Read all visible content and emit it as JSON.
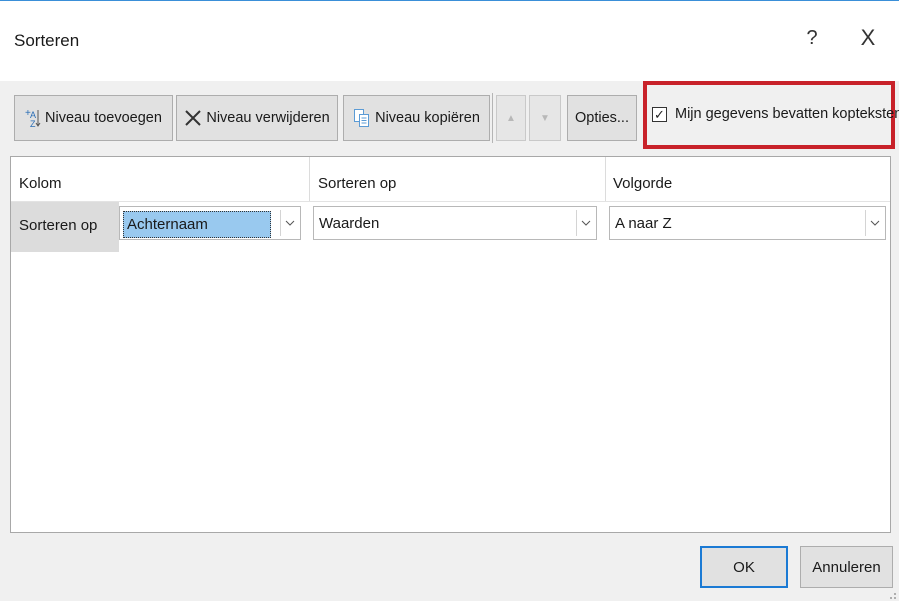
{
  "dialog": {
    "title": "Sorteren",
    "help_label": "?",
    "close_label": "X"
  },
  "toolbar": {
    "add_level_label": "Niveau toevoegen",
    "delete_level_label": "Niveau verwijderen",
    "copy_level_label": "Niveau kopiëren",
    "move_up_label": "▲",
    "move_down_label": "▼",
    "options_label": "Opties...",
    "headers_checkbox_label": "Mijn gegevens bevatten kopteksten",
    "headers_checkbox_checked": true
  },
  "grid": {
    "headers": {
      "column": "Kolom",
      "sort_on": "Sorteren op",
      "order": "Volgorde"
    },
    "rows": [
      {
        "label": "Sorteren op",
        "column_value": "Achternaam",
        "sort_on_value": "Waarden",
        "order_value": "A naar Z"
      }
    ]
  },
  "footer": {
    "ok_label": "OK",
    "cancel_label": "Annuleren"
  },
  "colors": {
    "highlight_border": "#c8222a",
    "selection": "#99c9ef",
    "default_button_border": "#1b7ad4",
    "title_accent": "#3a8fd8"
  }
}
